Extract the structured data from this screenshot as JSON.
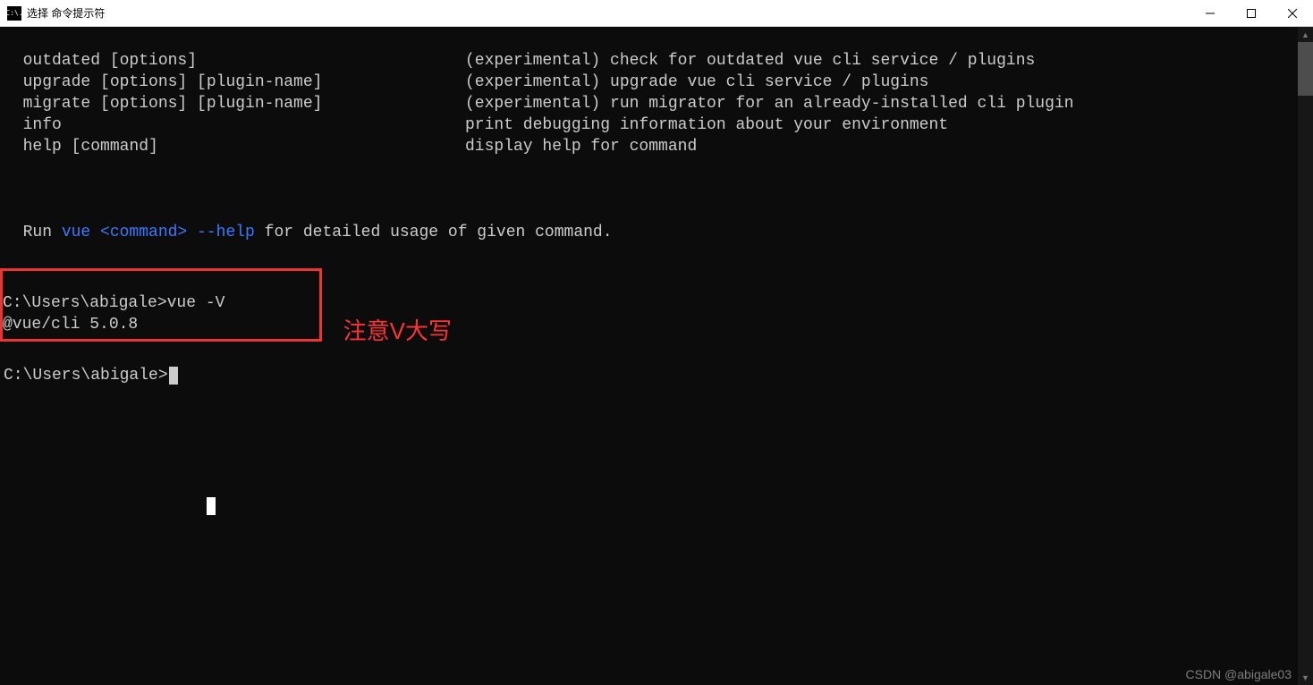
{
  "titlebar": {
    "icon_text": "C:\\.",
    "title": "选择 命令提示符"
  },
  "help_commands": [
    {
      "cmd": "  outdated [options]",
      "desc": "(experimental) check for outdated vue cli service / plugins"
    },
    {
      "cmd": "  upgrade [options] [plugin-name]",
      "desc": "(experimental) upgrade vue cli service / plugins"
    },
    {
      "cmd": "  migrate [options] [plugin-name]",
      "desc": "(experimental) run migrator for an already-installed cli plugin"
    },
    {
      "cmd": "  info",
      "desc": "print debugging information about your environment"
    },
    {
      "cmd": "  help [command]",
      "desc": "display help for command"
    }
  ],
  "run_line": {
    "prefix": "  Run ",
    "vue": "vue <command> --help",
    "suffix": " for detailed usage of given command."
  },
  "boxed": {
    "line1": "C:\\Users\\abigale>vue -V",
    "line2": "@vue/cli 5.0.8"
  },
  "annotation": "注意V大写",
  "prompt2": "C:\\Users\\abigale>",
  "watermark": "CSDN @abigale03"
}
